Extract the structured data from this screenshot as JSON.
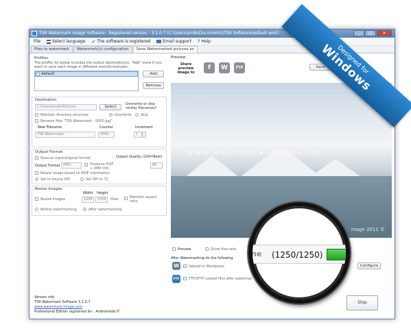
{
  "window": {
    "title": "TSR Watermark Image Software - Registered version - 3.1.0.7 (C:\\Users\\ande\\Documents\\TSR Software\\default.wmi)",
    "controls": [
      "_",
      "□",
      "✕"
    ]
  },
  "menu": {
    "file": "File",
    "language": "Select language",
    "registered": "The software is registered",
    "email": "Email support",
    "help": "Help"
  },
  "tabs": [
    "Files to watermark",
    "Watermark(s) configuration",
    "Save Watermarked pictures as"
  ],
  "profiles": {
    "title": "Profiles",
    "description": "The profile list below includes the output destination(s). \"Add\" more if you want to save each image in different sizes/formats/etc..",
    "items": [
      "default"
    ],
    "add": "Add",
    "remove": "Remove"
  },
  "destination": {
    "title": "Destination",
    "path": "C:\\Users\\ande\\Pictures",
    "select": "Select",
    "overwrite_q": "Overwrite or skip similar filenames?",
    "maintain": "Maintain directory structure",
    "overwrite": "Overwrite",
    "skip": "Skip",
    "rename": "Rename files \"TSR Watermark - 0000.jpg\"",
    "new_filename_label": "New Filename",
    "counter_label": "Counter",
    "increment_label": "Increment",
    "new_filename": "TSR Watermark -",
    "counter": "0000",
    "increment": "1"
  },
  "output": {
    "title": "Output Format",
    "save_original": "Save as input/original format",
    "quality_label": "Output Quality (100=Best)",
    "format_label": "Output Format",
    "format": "JPEG",
    "preserve": "Preserve EXIF + XMP Info",
    "quality": "90",
    "rotate": "Rotate image based on EXIF information",
    "set_source": "Set to source DPI",
    "set_72": "Set DPI to 72"
  },
  "resize": {
    "title": "Resize Images",
    "width_label": "Width",
    "height_label": "Height",
    "resize": "Resize Images",
    "width": "1200",
    "height": "1000",
    "unit": "Pixel",
    "aspect": "Maintain aspect ratio",
    "before": "Before watermarking",
    "after": "After watermarking"
  },
  "version": {
    "title": "Version info",
    "line1": "TSR Watermark Software 3.1.0.7",
    "link": "www.watermark-image.com",
    "line3": "Professional Edition registered for : Andromeda IT"
  },
  "preview": {
    "title": "Preview",
    "share_label": "Share preview image to",
    "share_icons": [
      "f",
      "W",
      "FTP"
    ],
    "save": "Save",
    "watermark_text": "www.watermark-image.com",
    "corner_text": "mage 2011 ©",
    "preview_chk": "Preview",
    "show_files": "Show files whe"
  },
  "after": {
    "title": "After Watermarking do the following",
    "upload_wp": "Upload to Wordpress",
    "ftp": "FTP/SFTP upload files after watermar",
    "configure": "Configure",
    "stop": "Stop"
  },
  "progress": {
    "brand_fragment": "ne",
    "count": "(1250/1250)",
    "fraction": 1.0
  },
  "ribbon": {
    "line1": "Designed for",
    "line2": "Windows"
  },
  "colors": {
    "title_bar": "#5f87b5",
    "progress": "#1fa51f",
    "ribbon": "#1f74bb"
  }
}
